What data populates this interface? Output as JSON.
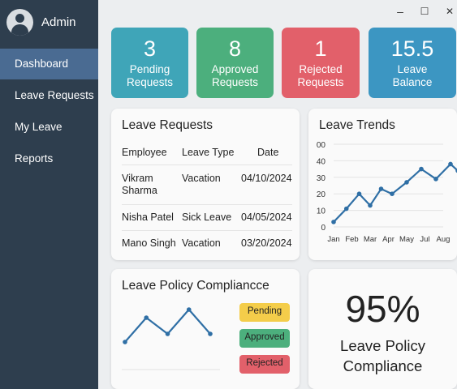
{
  "user": {
    "name": "Admin",
    "avatar_icon": "user-avatar-icon"
  },
  "window": {
    "minimize": "–",
    "maximize": "☐",
    "close": "✕"
  },
  "nav": [
    {
      "label": "Dashboard",
      "active": true
    },
    {
      "label": "Leave Requests",
      "active": false
    },
    {
      "label": "My Leave",
      "active": false
    },
    {
      "label": "Reports",
      "active": false
    }
  ],
  "stats": [
    {
      "value": "3",
      "label_line1": "Pending",
      "label_line2": "Requests",
      "color": "#3fa5b8"
    },
    {
      "value": "8",
      "label_line1": "Approved",
      "label_line2": "Requests",
      "color": "#4caf7d"
    },
    {
      "value": "1",
      "label_line1": "Rejected",
      "label_line2": "Requests",
      "color": "#e2606a"
    },
    {
      "value": "15.5",
      "label_line1": "Leave",
      "label_line2": "Balance",
      "color": "#3c96c2"
    }
  ],
  "leave_requests": {
    "title": "Leave Requests",
    "headers": [
      "Employee",
      "Leave Type",
      "Date"
    ],
    "rows": [
      {
        "employee_line1": "Vikram",
        "employee_line2": "Sharma",
        "type": "Vacation",
        "date": "04/10/2024"
      },
      {
        "employee_line1": "Nisha Patel",
        "employee_line2": "",
        "type": "Sick Leave",
        "date": "04/05/2024"
      },
      {
        "employee_line1": "Mano Singh",
        "employee_line2": "",
        "type": "Vacation",
        "date": "03/20/2024"
      }
    ]
  },
  "leave_trends": {
    "title": "Leave Trends"
  },
  "chart_data": [
    {
      "type": "line",
      "title": "Leave Trends",
      "xlabel": "",
      "ylabel": "",
      "ylim": [
        0,
        50
      ],
      "y_ticks": [
        "0",
        "10",
        "20",
        "30",
        "40",
        "00"
      ],
      "categories": [
        "Jan",
        "Feb",
        "Mar",
        "Apr",
        "May",
        "Jul",
        "Aug"
      ],
      "x": [
        0,
        0.7,
        1.4,
        2.0,
        2.6,
        3.2,
        4.0,
        4.8,
        5.6,
        6.4,
        6.8
      ],
      "values": [
        3,
        11,
        20,
        13,
        23,
        20,
        27,
        35,
        29,
        38,
        34
      ],
      "grid": true,
      "color": "#2f6fa5"
    },
    {
      "type": "line",
      "title": "",
      "values": [
        2,
        5,
        3,
        6,
        3
      ],
      "ylim": [
        0,
        8
      ],
      "color": "#2f6fa5"
    }
  ],
  "compliance": {
    "title": "Leave Policy Compliancce",
    "badges": [
      {
        "label": "Pending",
        "color": "#f4cd4a"
      },
      {
        "label": "Approved",
        "color": "#4caf7d"
      },
      {
        "label": "Rejected",
        "color": "#e2606a"
      }
    ]
  },
  "compliance_stat": {
    "value": "95%",
    "label_line1": "Leave Policy",
    "label_line2": "Compliance"
  }
}
